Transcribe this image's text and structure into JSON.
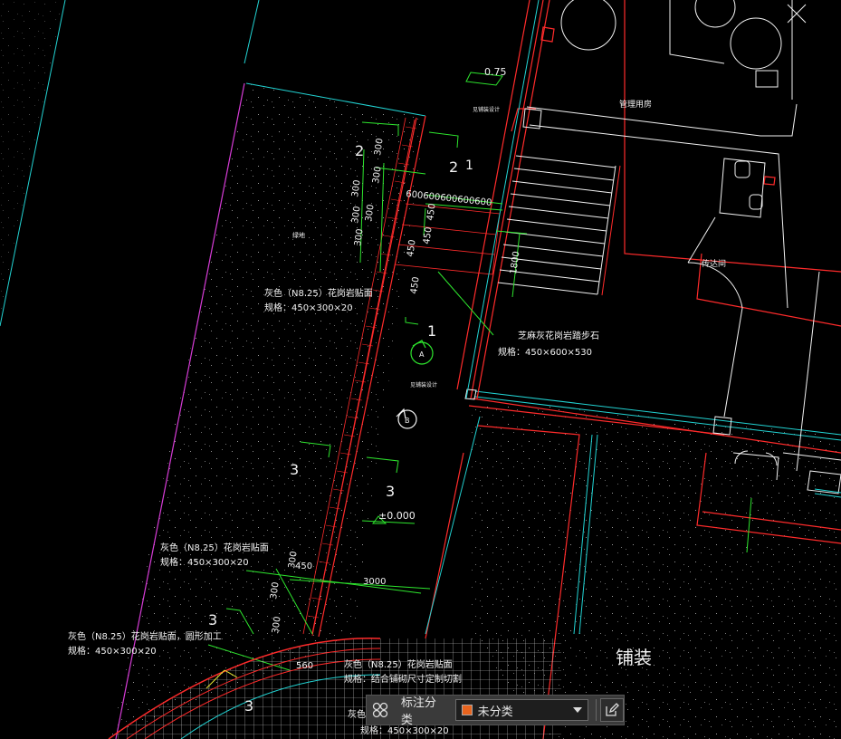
{
  "drawing": {
    "elevation_top": "0.75",
    "elevation_bottom": "±0.000",
    "room_mgmt": "管理用房",
    "room_guard": "传达间",
    "label_green": "绿地",
    "label_stair_top": "见铺装设计",
    "label_stair_mid": "见铺装设计",
    "pavement": "铺装",
    "note1_line1": "灰色（N8.25）花岗岩贴面",
    "note1_line2": "规格：450×300×20",
    "note2_line1": "芝麻灰花岗岩踏步石",
    "note2_line2": "规格：450×600×530",
    "note3_line1": "灰色（N8.25）花岗岩贴面",
    "note3_line2": "规格：450×300×20",
    "note4_line1": "灰色（N8.25）花岗岩贴面，圆形加工",
    "note4_line2": "规格：450×300×20",
    "note5_line1": "灰色（N8.25）花岗岩贴面",
    "note5_line2": "规格：结合铺砌尺寸定制切割",
    "note6_line1": "灰色",
    "note6_line2": "规格：450×300×20",
    "sec_2a": "2",
    "sec_2b": "2",
    "sec_1a": "1",
    "sec_1b": "1",
    "sec_3a": "3",
    "sec_3b": "3",
    "sec_3c": "3",
    "sec_3d": "3",
    "marker_a": "A",
    "marker_b": "B",
    "dim_600_run": "600600600600600",
    "dim_300a": "300",
    "dim_300b": "300",
    "dim_300c": "300",
    "dim_300d": "300",
    "dim_300e": "300",
    "dim_300f": "300",
    "dim_300g": "300",
    "dim_300h": "300",
    "dim_300i": "300",
    "dim_450a": "450",
    "dim_450b": "450",
    "dim_450c": "450",
    "dim_450d": "450",
    "dim_450e": "450",
    "dim_1800": "1800",
    "dim_3000": "3000",
    "dim_560": "560"
  },
  "toolbar": {
    "category_label": "标注分类",
    "category_value": "未分类",
    "swatch_color": "#e8641e",
    "icons": [
      "grid-icon",
      "caret-down-icon",
      "edit-icon"
    ]
  }
}
